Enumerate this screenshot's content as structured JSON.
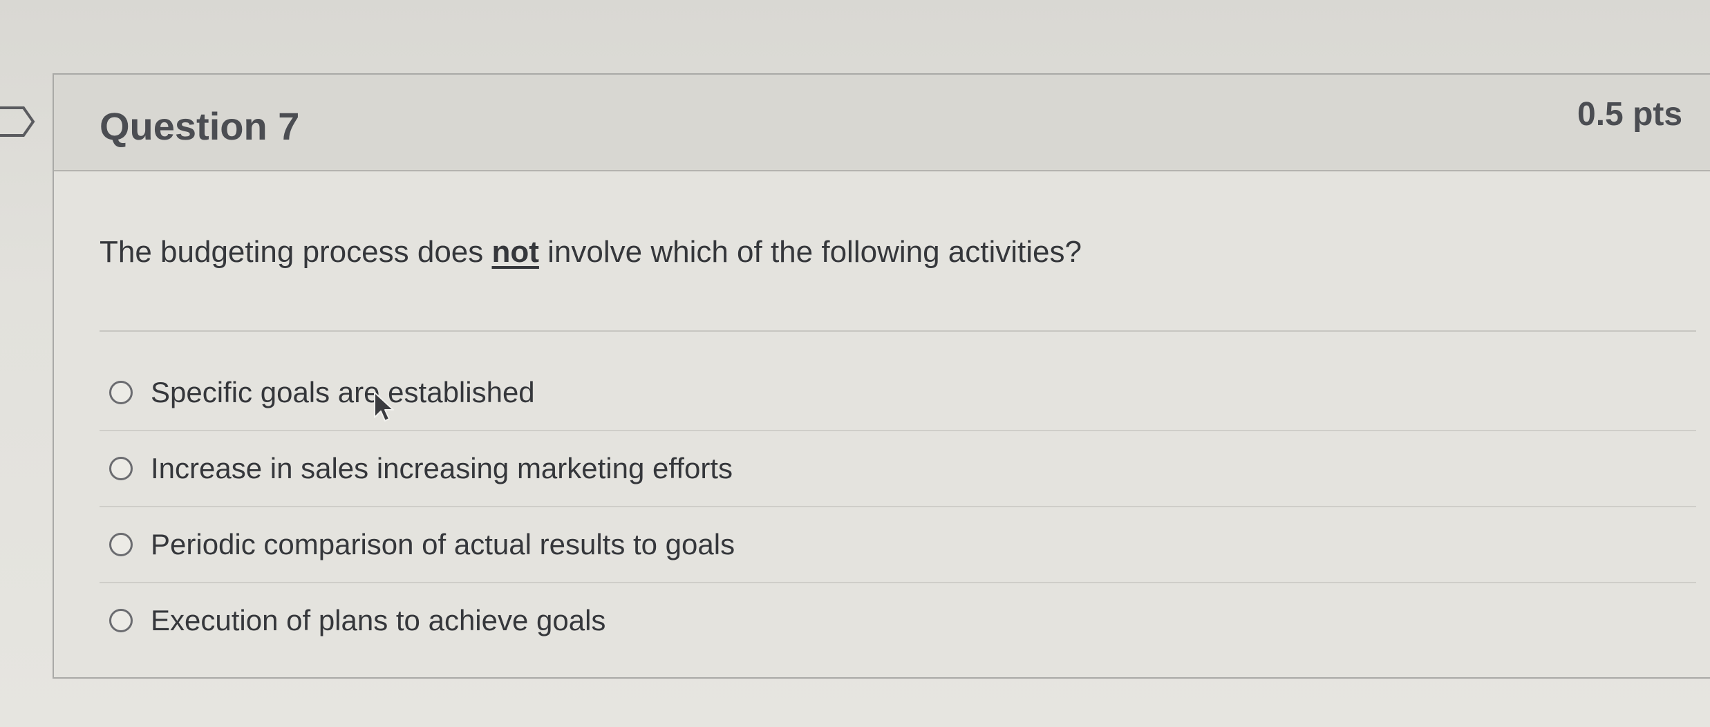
{
  "question": {
    "title": "Question 7",
    "points": "0.5 pts",
    "text_before": "The budgeting process does ",
    "text_emphasis": "not",
    "text_after": " involve which of the following activities?"
  },
  "answers": [
    {
      "label": "Specific goals are established",
      "selected": false
    },
    {
      "label": "Increase in sales increasing marketing efforts",
      "selected": false
    },
    {
      "label": "Periodic comparison of actual results to goals",
      "selected": false
    },
    {
      "label": "Execution of plans to achieve goals",
      "selected": false
    }
  ],
  "icons": {
    "flag": "bookmark-flag-icon",
    "radio": "radio-button-icon",
    "cursor": "mouse-pointer-icon"
  },
  "colors": {
    "background": "#dcdbd6",
    "header": "#d8d7d2",
    "text": "#35373b",
    "border": "#a9a9a6"
  }
}
